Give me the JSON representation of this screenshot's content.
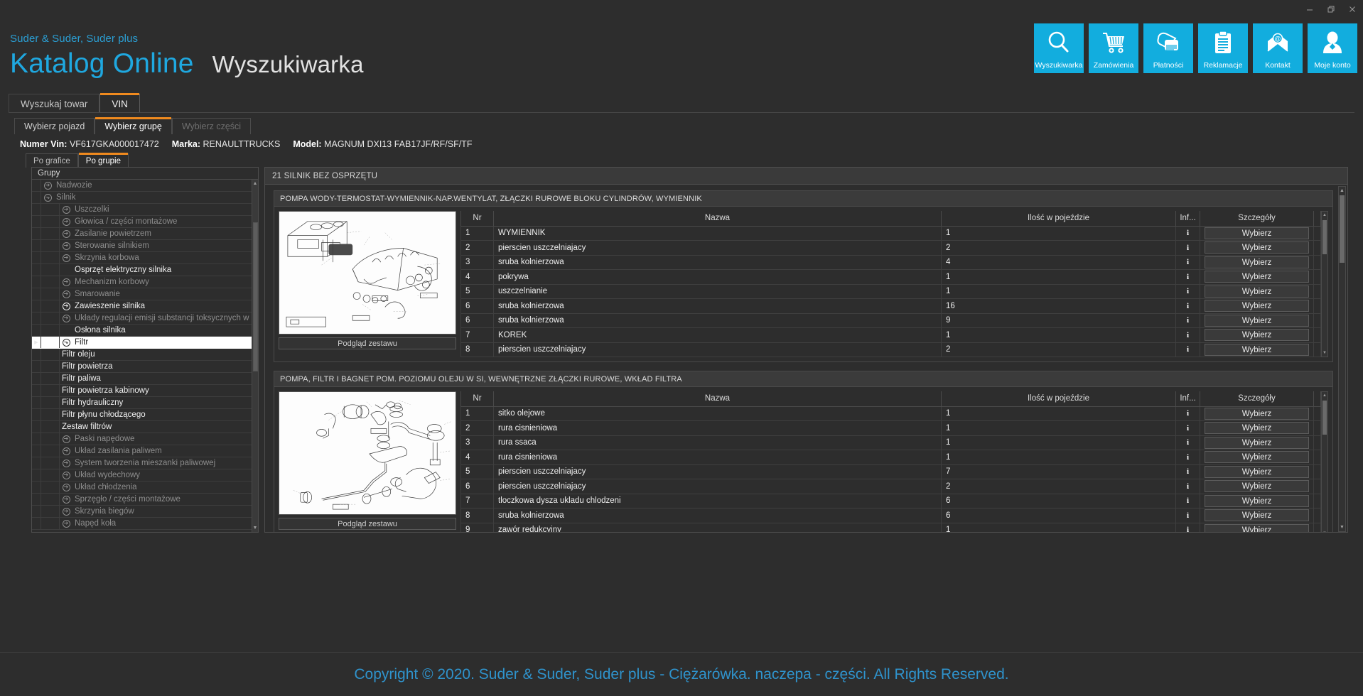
{
  "window": {
    "minimize": "minimize-icon",
    "restore": "restore-icon",
    "close": "close-icon"
  },
  "header": {
    "brand_line": "Suder & Suder, Suder plus",
    "title_main": "Katalog Online",
    "title_sub": "Wyszukiwarka",
    "accent_blue": "#12adde",
    "accent_orange": "#f08a1e"
  },
  "nav_tiles": [
    {
      "label": "Wyszukiwarka",
      "icon": "search-icon"
    },
    {
      "label": "Zamówienia",
      "icon": "cart-icon"
    },
    {
      "label": "Płatności",
      "icon": "payment-icon"
    },
    {
      "label": "Reklamacje",
      "icon": "clipboard-icon"
    },
    {
      "label": "Kontakt",
      "icon": "mail-icon"
    },
    {
      "label": "Moje konto",
      "icon": "user-icon"
    }
  ],
  "tabs_level1": [
    {
      "label": "Wyszukaj towar",
      "active": false,
      "disabled": false
    },
    {
      "label": "VIN",
      "active": true,
      "disabled": false
    }
  ],
  "tabs_level2": [
    {
      "label": "Wybierz pojazd",
      "active": false,
      "disabled": false
    },
    {
      "label": "Wybierz grupę",
      "active": true,
      "disabled": false
    },
    {
      "label": "Wybierz części",
      "active": false,
      "disabled": true
    }
  ],
  "vin_bar": [
    {
      "label": "Numer Vin:",
      "value": "VF617GKA000017472"
    },
    {
      "label": "Marka:",
      "value": "RENAULTTRUCKS"
    },
    {
      "label": "Model:",
      "value": "MAGNUM DXI13 FAB17JF/RF/SF/TF"
    }
  ],
  "tabs_level3": [
    {
      "label": "Po grafice",
      "active": false
    },
    {
      "label": "Po grupie",
      "active": true
    }
  ],
  "tree": {
    "header": "Grupy",
    "items": [
      {
        "label": "Nadwozie",
        "level": 1,
        "expander": "arrow-right",
        "enabled": false,
        "selected": false
      },
      {
        "label": "Silnik",
        "level": 1,
        "expander": "arrow-down",
        "enabled": false,
        "selected": false
      },
      {
        "label": "Uszczelki",
        "level": 2,
        "expander": "arrow-right",
        "enabled": false,
        "selected": false
      },
      {
        "label": "Głowica / części montażowe",
        "level": 2,
        "expander": "arrow-right",
        "enabled": false,
        "selected": false
      },
      {
        "label": "Zasilanie powietrzem",
        "level": 2,
        "expander": "arrow-right",
        "enabled": false,
        "selected": false
      },
      {
        "label": "Sterowanie silnikiem",
        "level": 2,
        "expander": "arrow-right",
        "enabled": false,
        "selected": false
      },
      {
        "label": "Skrzynia korbowa",
        "level": 2,
        "expander": "arrow-right",
        "enabled": false,
        "selected": false
      },
      {
        "label": "Osprzęt elektryczny silnika",
        "level": 2,
        "expander": "none",
        "enabled": true,
        "selected": false
      },
      {
        "label": "Mechanizm korbowy",
        "level": 2,
        "expander": "arrow-right",
        "enabled": false,
        "selected": false
      },
      {
        "label": "Smarowanie",
        "level": 2,
        "expander": "arrow-right",
        "enabled": false,
        "selected": false
      },
      {
        "label": "Zawieszenie silnika",
        "level": 2,
        "expander": "arrow-right",
        "enabled": true,
        "selected": false
      },
      {
        "label": "Układy regulacji emisji substancji toksycznych w spalinach",
        "level": 2,
        "expander": "arrow-right",
        "enabled": false,
        "selected": false
      },
      {
        "label": "Osłona silnika",
        "level": 2,
        "expander": "none",
        "enabled": true,
        "selected": false
      },
      {
        "label": "Filtr",
        "level": 2,
        "expander": "arrow-down",
        "enabled": true,
        "selected": true
      },
      {
        "label": "Filtr oleju",
        "level": 3,
        "expander": "none",
        "enabled": true,
        "selected": false
      },
      {
        "label": "Filtr powietrza",
        "level": 3,
        "expander": "none",
        "enabled": true,
        "selected": false
      },
      {
        "label": "Filtr paliwa",
        "level": 3,
        "expander": "none",
        "enabled": true,
        "selected": false
      },
      {
        "label": "Filtr powietrza kabinowy",
        "level": 3,
        "expander": "none",
        "enabled": true,
        "selected": false
      },
      {
        "label": "Filtr hydrauliczny",
        "level": 3,
        "expander": "none",
        "enabled": true,
        "selected": false
      },
      {
        "label": "Filtr płynu chłodzącego",
        "level": 3,
        "expander": "none",
        "enabled": true,
        "selected": false
      },
      {
        "label": "Zestaw filtrów",
        "level": 3,
        "expander": "none",
        "enabled": true,
        "selected": false
      },
      {
        "label": "Paski napędowe",
        "level": 2,
        "expander": "arrow-right",
        "enabled": false,
        "selected": false
      },
      {
        "label": "Układ zasilania paliwem",
        "level": 2,
        "expander": "arrow-right",
        "enabled": false,
        "selected": false
      },
      {
        "label": "System tworzenia mieszanki paliwowej",
        "level": 2,
        "expander": "arrow-right",
        "enabled": false,
        "selected": false
      },
      {
        "label": "Układ wydechowy",
        "level": 2,
        "expander": "arrow-right",
        "enabled": false,
        "selected": false
      },
      {
        "label": "Układ chłodzenia",
        "level": 2,
        "expander": "arrow-right",
        "enabled": false,
        "selected": false
      },
      {
        "label": "Sprzęgło / części montażowe",
        "level": 2,
        "expander": "arrow-right",
        "enabled": false,
        "selected": false
      },
      {
        "label": "Skrzynia biegów",
        "level": 2,
        "expander": "arrow-right",
        "enabled": false,
        "selected": false
      },
      {
        "label": "Napęd koła",
        "level": 2,
        "expander": "arrow-right",
        "enabled": false,
        "selected": false
      }
    ]
  },
  "content": {
    "title": "21 SILNIK BEZ OSPRZĘTU",
    "thumb_caption": "Podgląd zestawu",
    "columns": [
      "Nr",
      "Nazwa",
      "Ilość w pojeździe",
      "Inf...",
      "Szczegóły"
    ],
    "select_label": "Wybierz",
    "info_label": "i",
    "groups": [
      {
        "title": "POMPA WODY-TERMOSTAT-WYMIENNIK-NAP.WENTYLAT, ZŁĄCZKI RUROWE BLOKU CYLINDRÓW, WYMIENNIK",
        "thumb": "engine-block-diagram",
        "rows": [
          {
            "nr": "1",
            "name": "WYMIENNIK",
            "qty": "1"
          },
          {
            "nr": "2",
            "name": "pierscien uszczelniajacy",
            "qty": "2"
          },
          {
            "nr": "3",
            "name": "sruba kolnierzowa",
            "qty": "4"
          },
          {
            "nr": "4",
            "name": "pokrywa",
            "qty": "1"
          },
          {
            "nr": "5",
            "name": "uszczelnianie",
            "qty": "1"
          },
          {
            "nr": "6",
            "name": "sruba kolnierzowa",
            "qty": "16"
          },
          {
            "nr": "6",
            "name": "sruba kolnierzowa",
            "qty": "9"
          },
          {
            "nr": "7",
            "name": "KOREK",
            "qty": "1"
          },
          {
            "nr": "8",
            "name": "pierscien uszczelniajacy",
            "qty": "2"
          }
        ]
      },
      {
        "title": "POMPA, FILTR I BAGNET POM. POZIOMU OLEJU W SI, WEWNĘTRZNE ZŁĄCZKI RUROWE, WKŁAD FILTRA",
        "thumb": "oil-pump-diagram",
        "rows": [
          {
            "nr": "1",
            "name": "sitko olejowe",
            "qty": "1"
          },
          {
            "nr": "2",
            "name": "rura cisnieniowa",
            "qty": "1"
          },
          {
            "nr": "3",
            "name": "rura ssaca",
            "qty": "1"
          },
          {
            "nr": "4",
            "name": "rura cisnieniowa",
            "qty": "1"
          },
          {
            "nr": "5",
            "name": "pierscien uszczelniajacy",
            "qty": "7"
          },
          {
            "nr": "6",
            "name": "pierscien uszczelniajacy",
            "qty": "2"
          },
          {
            "nr": "7",
            "name": "tloczkowa dysza ukladu chlodzeni",
            "qty": "6"
          },
          {
            "nr": "8",
            "name": "sruba kolnierzowa",
            "qty": "6"
          },
          {
            "nr": "9",
            "name": "zawór redukcyjny",
            "qty": "1"
          }
        ]
      }
    ]
  },
  "footer": {
    "copyright": "Copyright © 2020. Suder & Suder, Suder plus - Ciężarówka. naczepa - części. All Rights Reserved."
  }
}
